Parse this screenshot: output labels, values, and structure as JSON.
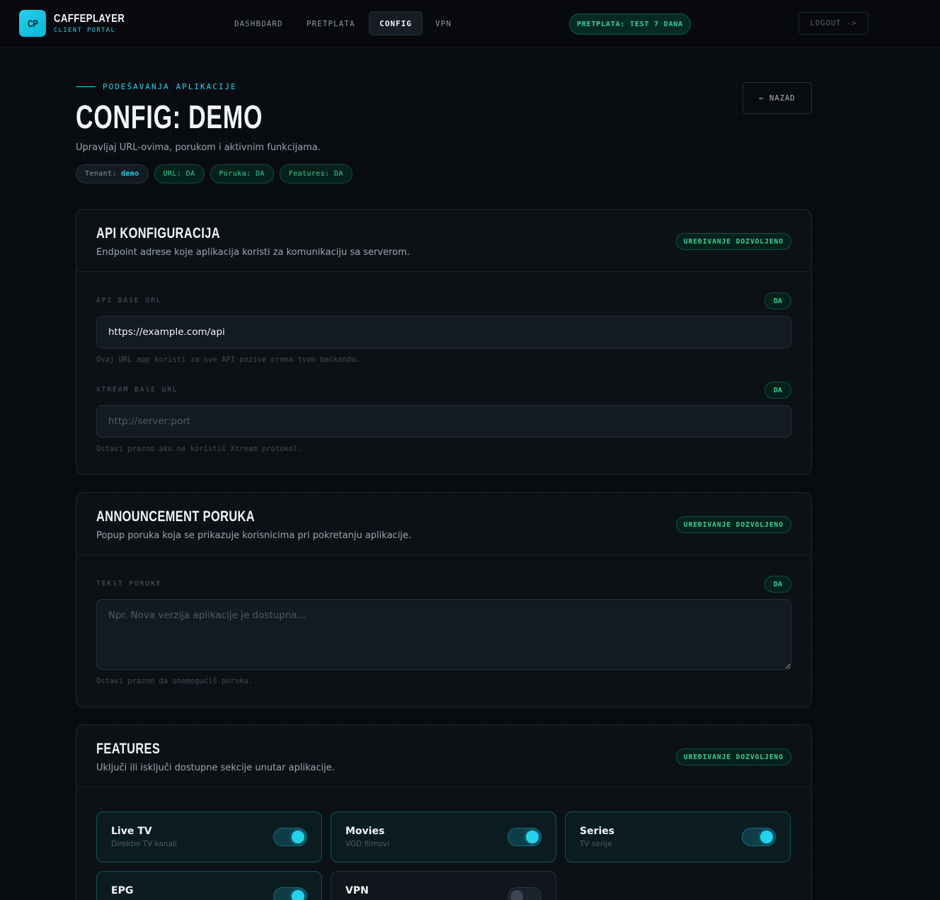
{
  "brand": {
    "logo": "CP",
    "name": "CAFFEPLAYER",
    "subtitle": "CLIENT PORTAL"
  },
  "nav": {
    "items": [
      {
        "label": "DASHBOARD"
      },
      {
        "label": "PRETPLATA"
      },
      {
        "label": "CONFIG",
        "active": true
      },
      {
        "label": "VPN"
      }
    ],
    "subscription": "PRETPLATA: TEST 7 DANA",
    "logout": "LOGOUT ->"
  },
  "header": {
    "eyebrow": "PODEŠAVANJA APLIKACIJE",
    "title": "CONFIG: DEMO",
    "subtitle": "Upravljaj URL-ovima, porukom i aktivnim funkcijama.",
    "back": "← NAZAD",
    "chips": {
      "tenant_label": "Tenant:",
      "tenant_value": "demo",
      "url": "URL: DA",
      "poruka": "Poruka: DA",
      "features": "Features: DA"
    }
  },
  "api_card": {
    "title": "API KONFIGURACIJA",
    "description": "Endpoint adrese koje aplikacija koristi za komunikaciju sa serverom.",
    "badge": "UREĐIVANJE DOZVOLJENO",
    "fields": [
      {
        "label": "API BASE URL",
        "status": "DA",
        "value": "https://example.com/api",
        "placeholder": "",
        "hint": "Ovaj URL app koristi za sve API pozive prema tvom backendu."
      },
      {
        "label": "XTREAM BASE URL",
        "status": "DA",
        "value": "",
        "placeholder": "http://server:port",
        "hint": "Ostavi prazno ako ne koristiš Xtream protokol."
      }
    ]
  },
  "announcement_card": {
    "title": "ANNOUNCEMENT PORUKA",
    "description": "Popup poruka koja se prikazuje korisnicima pri pokretanju aplikacije.",
    "badge": "UREĐIVANJE DOZVOLJENO",
    "field": {
      "label": "TEKST PORUKE",
      "status": "DA",
      "value": "",
      "placeholder": "Npr. Nova verzija aplikacije je dostupna...",
      "hint": "Ostavi prazno da onemogućiš poruku."
    }
  },
  "features_card": {
    "title": "FEATURES",
    "description": "Uključi ili isključi dostupne sekcije unutar aplikacije.",
    "badge": "UREĐIVANJE DOZVOLJENO",
    "items": [
      {
        "name": "Live TV",
        "desc": "Direktni TV kanali",
        "enabled": true
      },
      {
        "name": "Movies",
        "desc": "VOD filmovi",
        "enabled": true
      },
      {
        "name": "Series",
        "desc": "TV serije",
        "enabled": true
      },
      {
        "name": "EPG",
        "desc": "",
        "enabled": true
      },
      {
        "name": "VPN",
        "desc": "",
        "enabled": false
      }
    ]
  },
  "colors": {
    "accent": "#22d3ee",
    "success": "#34d399",
    "background": "#080c10"
  }
}
